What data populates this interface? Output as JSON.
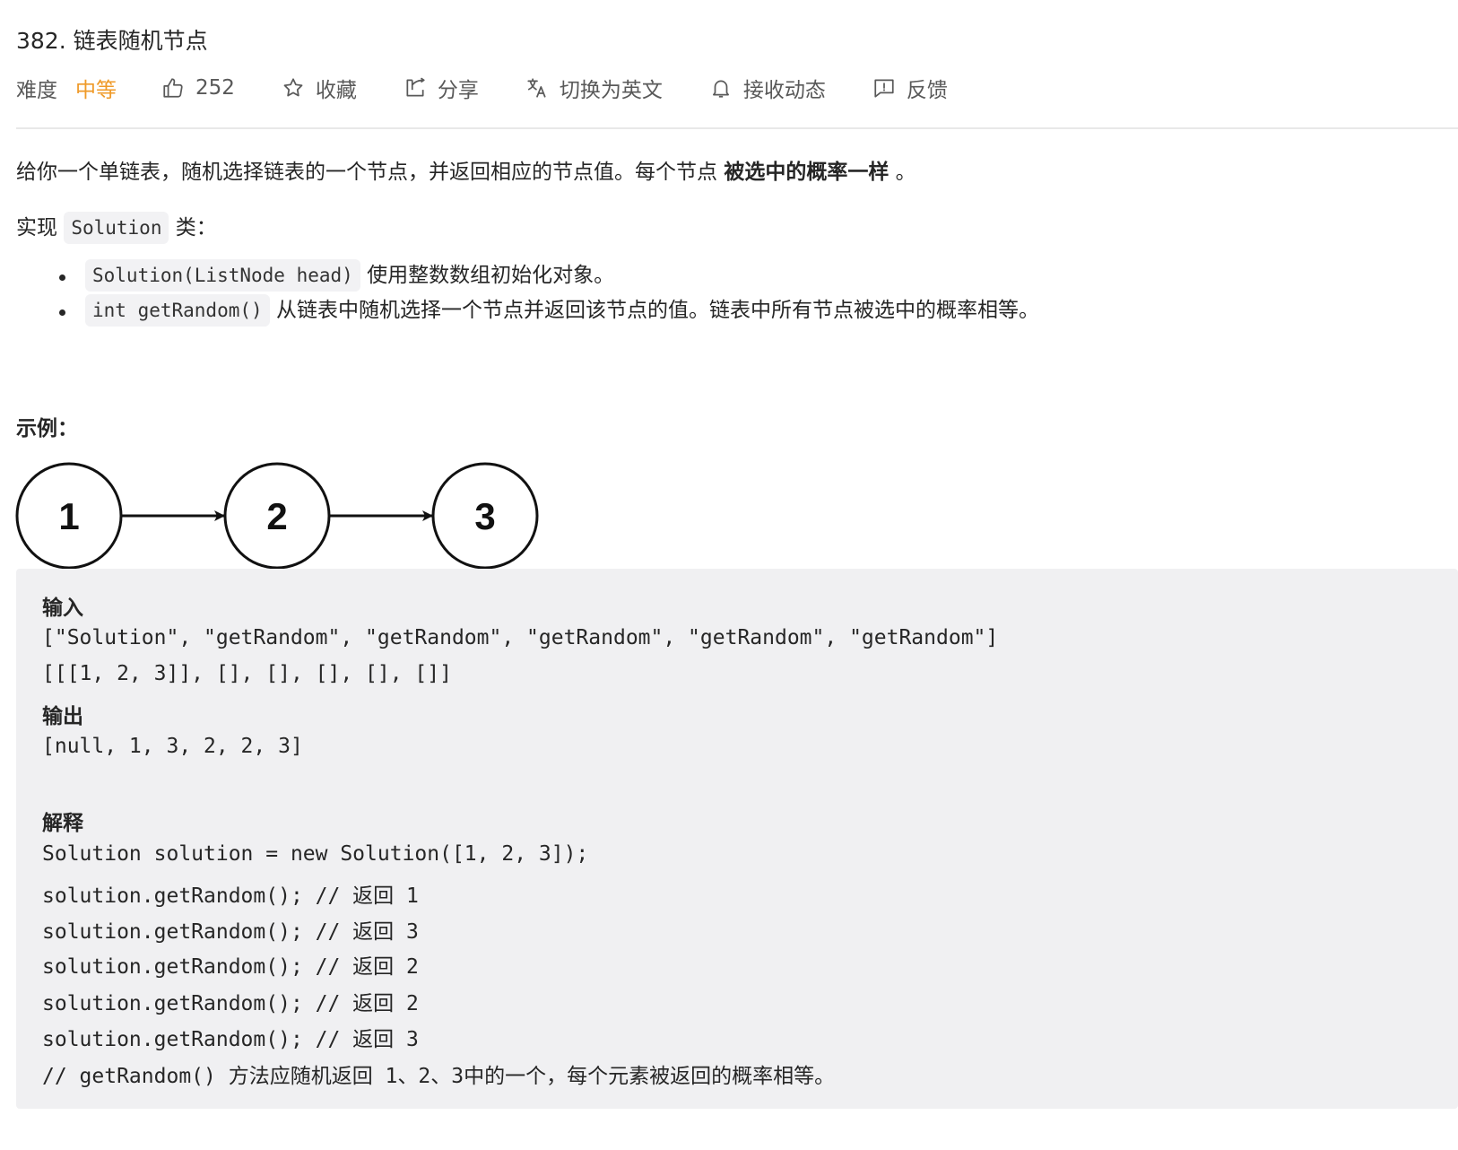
{
  "problem": {
    "title": "382. 链表随机节点",
    "difficulty_label": "难度",
    "difficulty_value": "中等",
    "like_count": "252",
    "favorite_label": "收藏",
    "share_label": "分享",
    "switch_lang_label": "切换为英文",
    "subscribe_label": "接收动态",
    "feedback_label": "反馈"
  },
  "description": {
    "intro_plain": "给你一个单链表，随机选择链表的一个节点，并返回相应的节点值。每个节点 ",
    "intro_bold": "被选中的概率一样",
    "intro_end": " 。",
    "impl_prefix": "实现 ",
    "impl_class": "Solution",
    "impl_suffix": " 类：",
    "methods": [
      {
        "code": "Solution(ListNode head)",
        "text": " 使用整数数组初始化对象。"
      },
      {
        "code": "int getRandom()",
        "text": " 从链表中随机选择一个节点并返回该节点的值。链表中所有节点被选中的概率相等。"
      }
    ]
  },
  "example": {
    "label": "示例：",
    "nodes": [
      "1",
      "2",
      "3"
    ],
    "lines": [
      {
        "text": "输入",
        "bold": true
      },
      {
        "text": "[\"Solution\", \"getRandom\", \"getRandom\", \"getRandom\", \"getRandom\", \"getRandom\"]",
        "bold": false
      },
      {
        "text": "[[[1, 2, 3]], [], [], [], [], []]",
        "bold": false
      },
      {
        "text": "输出",
        "bold": true
      },
      {
        "text": "[null, 1, 3, 2, 2, 3]",
        "bold": false
      },
      {
        "text": "解释",
        "bold": true
      },
      {
        "text": "Solution solution = new Solution([1, 2, 3]);",
        "bold": false
      },
      {
        "text": "solution.getRandom(); // 返回 1",
        "bold": false
      },
      {
        "text": "solution.getRandom(); // 返回 3",
        "bold": false
      },
      {
        "text": "solution.getRandom(); // 返回 2",
        "bold": false
      },
      {
        "text": "solution.getRandom(); // 返回 2",
        "bold": false
      },
      {
        "text": "solution.getRandom(); // 返回 3",
        "bold": false
      },
      {
        "text": "// getRandom() 方法应随机返回 1、2、3中的一个，每个元素被返回的概率相等。",
        "bold": false
      }
    ]
  },
  "colors": {
    "difficulty_medium": "#ef9a28",
    "code_block_bg": "#f0f0f2",
    "inline_code_bg": "#f2f2f4"
  },
  "icons": [
    "thumbs-up-icon",
    "star-icon",
    "share-icon",
    "translate-icon",
    "bell-icon",
    "feedback-icon"
  ]
}
